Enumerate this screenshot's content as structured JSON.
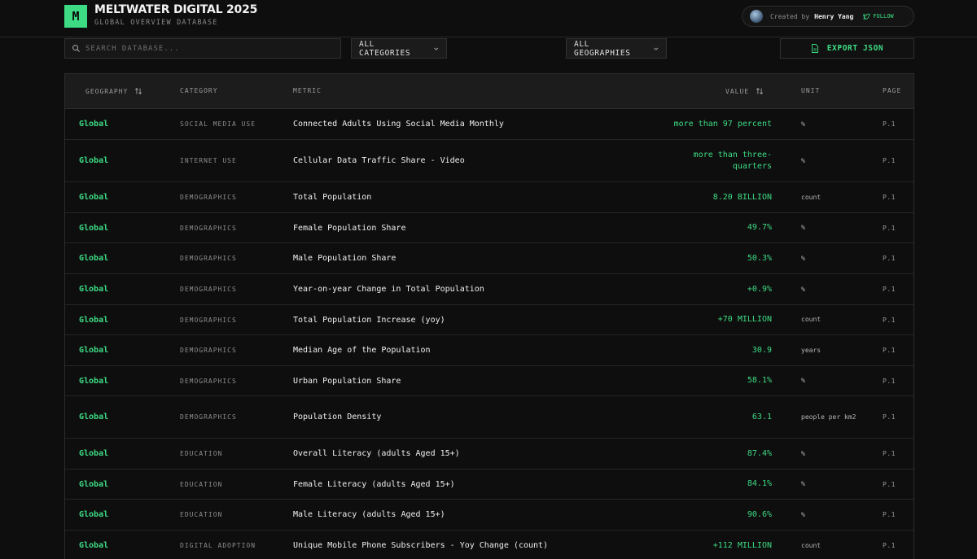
{
  "brand": {
    "logo_letter": "M",
    "title": "MELTWATER DIGITAL 2025",
    "subtitle": "GLOBAL OVERVIEW DATABASE"
  },
  "creator": {
    "prefix": "Created by",
    "name": "Henry Yang",
    "follow_label": "FOLLOW"
  },
  "toolbar": {
    "search_placeholder": "SEARCH DATABASE...",
    "category_filter": "ALL CATEGORIES",
    "geography_filter": "ALL GEOGRAPHIES",
    "export_label": "EXPORT JSON"
  },
  "table": {
    "headers": {
      "geography": "GEOGRAPHY",
      "category": "CATEGORY",
      "metric": "METRIC",
      "value": "VALUE",
      "unit": "UNIT",
      "page": "PAGE"
    },
    "rows": [
      {
        "geo": "Global",
        "cat": "SOCIAL MEDIA USE",
        "metric": "Connected Adults Using Social Media Monthly",
        "value": "more than 97 percent",
        "unit": "%",
        "page": "P.1"
      },
      {
        "geo": "Global",
        "cat": "INTERNET USE",
        "metric": "Cellular Data Traffic Share - Video",
        "value": "more than three-quarters",
        "unit": "%",
        "page": "P.1"
      },
      {
        "geo": "Global",
        "cat": "DEMOGRAPHICS",
        "metric": "Total Population",
        "value": "8.20 BILLION",
        "unit": "count",
        "page": "P.1"
      },
      {
        "geo": "Global",
        "cat": "DEMOGRAPHICS",
        "metric": "Female Population Share",
        "value": "49.7%",
        "unit": "%",
        "page": "P.1"
      },
      {
        "geo": "Global",
        "cat": "DEMOGRAPHICS",
        "metric": "Male Population Share",
        "value": "50.3%",
        "unit": "%",
        "page": "P.1"
      },
      {
        "geo": "Global",
        "cat": "DEMOGRAPHICS",
        "metric": "Year-on-year Change in Total Population",
        "value": "+0.9%",
        "unit": "%",
        "page": "P.1"
      },
      {
        "geo": "Global",
        "cat": "DEMOGRAPHICS",
        "metric": "Total Population Increase (yoy)",
        "value": "+70 MILLION",
        "unit": "count",
        "page": "P.1"
      },
      {
        "geo": "Global",
        "cat": "DEMOGRAPHICS",
        "metric": "Median Age of the Population",
        "value": "30.9",
        "unit": "years",
        "page": "P.1"
      },
      {
        "geo": "Global",
        "cat": "DEMOGRAPHICS",
        "metric": "Urban Population Share",
        "value": "58.1%",
        "unit": "%",
        "page": "P.1"
      },
      {
        "geo": "Global",
        "cat": "DEMOGRAPHICS",
        "metric": "Population Density",
        "value": "63.1",
        "unit": "people per km2",
        "page": "P.1"
      },
      {
        "geo": "Global",
        "cat": "EDUCATION",
        "metric": "Overall Literacy (adults Aged 15+)",
        "value": "87.4%",
        "unit": "%",
        "page": "P.1"
      },
      {
        "geo": "Global",
        "cat": "EDUCATION",
        "metric": "Female Literacy (adults Aged 15+)",
        "value": "84.1%",
        "unit": "%",
        "page": "P.1"
      },
      {
        "geo": "Global",
        "cat": "EDUCATION",
        "metric": "Male Literacy (adults Aged 15+)",
        "value": "90.6%",
        "unit": "%",
        "page": "P.1"
      },
      {
        "geo": "Global",
        "cat": "DIGITAL ADOPTION",
        "metric": "Unique Mobile Phone Subscribers - Yoy Change (count)",
        "value": "+112 MILLION",
        "unit": "count",
        "page": "P.1"
      }
    ]
  },
  "colors": {
    "accent": "#3ddc84",
    "background": "#0e0e0e",
    "header_bg": "#1c1c1c"
  }
}
